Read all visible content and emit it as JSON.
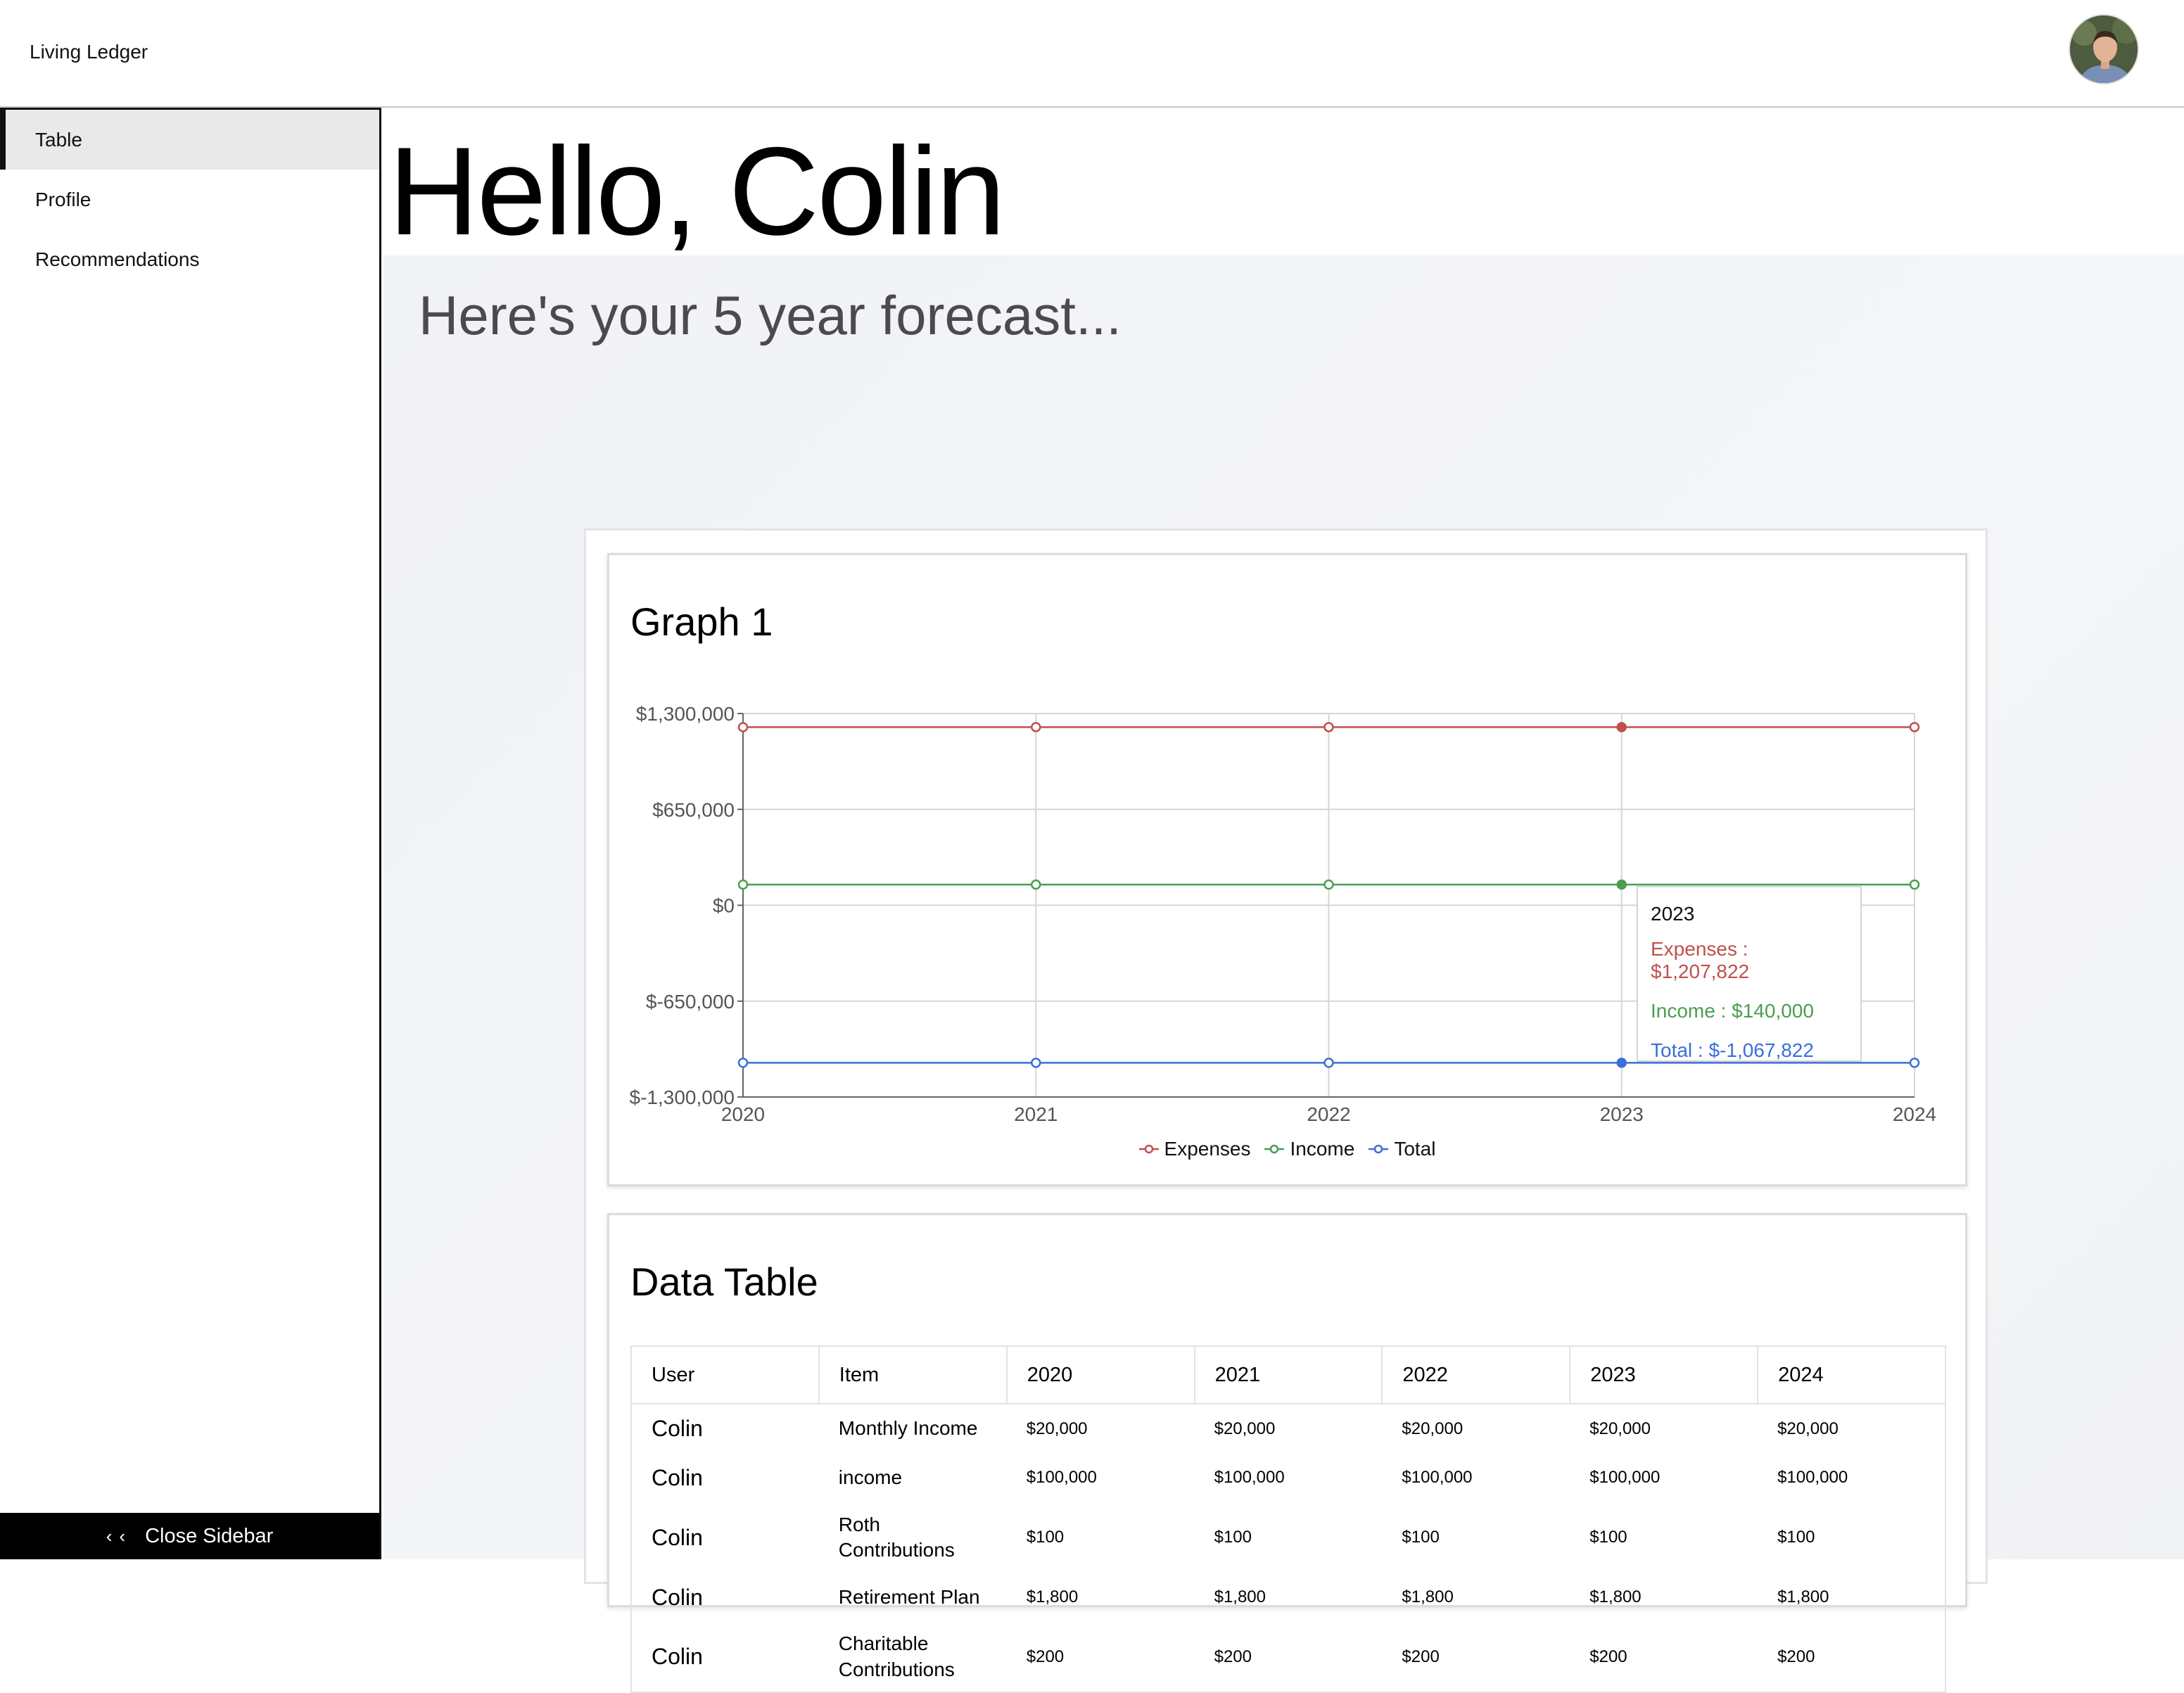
{
  "app": {
    "title": "Living Ledger"
  },
  "sidebar": {
    "items": [
      {
        "label": "Table",
        "active": true
      },
      {
        "label": "Profile",
        "active": false
      },
      {
        "label": "Recommendations",
        "active": false
      }
    ],
    "close_label": "Close Sidebar"
  },
  "main": {
    "greeting": "Hello, Colin",
    "subtitle": "Here's your 5 year forecast..."
  },
  "graph": {
    "title": "Graph 1",
    "tooltip": {
      "year": "2023",
      "expenses": "Expenses : $1,207,822",
      "income": "Income : $140,000",
      "total": "Total : $-1,067,822"
    }
  },
  "chart_data": {
    "type": "line",
    "x": [
      "2020",
      "2021",
      "2022",
      "2023",
      "2024"
    ],
    "ylim": [
      -1300000,
      1300000
    ],
    "yticks": [
      1300000,
      650000,
      0,
      -650000,
      -1300000
    ],
    "ytick_labels": [
      "$1,300,000",
      "$650,000",
      "$0",
      "$-650,000",
      "$-1,300,000"
    ],
    "legend_position": "bottom",
    "grid": true,
    "highlighted_index": 3,
    "series": [
      {
        "name": "Expenses",
        "color": "#c0504d",
        "values": [
          1207822,
          1207822,
          1207822,
          1207822,
          1207822
        ]
      },
      {
        "name": "Income",
        "color": "#4a9d50",
        "values": [
          140000,
          140000,
          140000,
          140000,
          140000
        ]
      },
      {
        "name": "Total",
        "color": "#3b6fd8",
        "values": [
          -1067822,
          -1067822,
          -1067822,
          -1067822,
          -1067822
        ]
      }
    ]
  },
  "table": {
    "title": "Data Table",
    "headers": [
      "User",
      "Item",
      "2020",
      "2021",
      "2022",
      "2023",
      "2024"
    ],
    "rows": [
      {
        "user": "Colin",
        "item": "Monthly Income",
        "values": [
          "$20,000",
          "$20,000",
          "$20,000",
          "$20,000",
          "$20,000"
        ]
      },
      {
        "user": "Colin",
        "item": "income",
        "values": [
          "$100,000",
          "$100,000",
          "$100,000",
          "$100,000",
          "$100,000"
        ]
      },
      {
        "user": "Colin",
        "item": "Roth Contributions",
        "values": [
          "$100",
          "$100",
          "$100",
          "$100",
          "$100"
        ]
      },
      {
        "user": "Colin",
        "item": "Retirement Plan",
        "values": [
          "$1,800",
          "$1,800",
          "$1,800",
          "$1,800",
          "$1,800"
        ]
      },
      {
        "user": "Colin",
        "item": "Charitable Contributions",
        "values": [
          "$200",
          "$200",
          "$200",
          "$200",
          "$200"
        ]
      }
    ]
  }
}
